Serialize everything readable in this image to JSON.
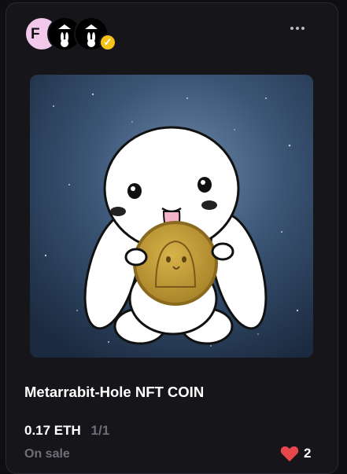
{
  "owner": {
    "avatar_initial": "F",
    "verified_icon": "check-badge-icon"
  },
  "menu_icon": "more-horizontal-icon",
  "artwork_description_icon": "nft-artwork",
  "nft": {
    "title": "Metarrabit-Hole NFT COIN",
    "price": "0.17 ETH",
    "editions": "1/1",
    "status": "On sale",
    "likes": "2"
  },
  "colors": {
    "background": "#0f0f11",
    "card": "#16161a",
    "verified": "#f4c21b",
    "heart": "#e8484c",
    "muted_text": "#6f6f77"
  }
}
